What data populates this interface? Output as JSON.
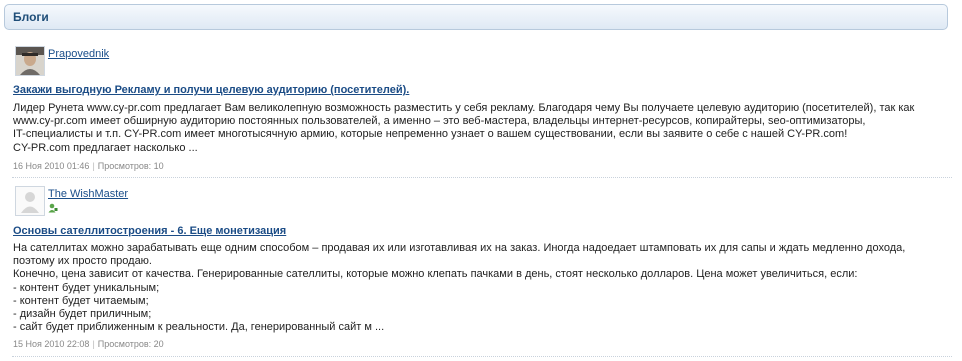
{
  "header": {
    "title": "Блоги"
  },
  "posts": [
    {
      "author": "Prapovednik",
      "title": "Закажи выгодную Рекламу и получи целевую аудиторию (посетителей).",
      "body_lines": [
        "Лидер Рунета www.cy-pr.com предлагает Вам великолепную возможность разместить у себя рекламу. Благодаря чему Вы получаете целевую аудиторию (посетителей), так как",
        "www.cy-pr.com имеет обширную аудиторию постоянных пользователей, а именно – это веб-мастера, владельцы интернет-ресурсов, копирайтеры, seo-оптимизаторы,",
        "IT-специалисты и т.п. CY-PR.com имеет многотысячную армию, которые непременно узнает о вашем существовании, если вы заявите о себе с нашей CY-PR.com!",
        "CY-PR.com предлагает насколько ..."
      ],
      "date": "16 Ноя 2010 01:46",
      "views": "Просмотров: 10"
    },
    {
      "author": "The WishMaster",
      "title": "Основы сателлитостроения - 6. Еще монетизация",
      "body_lines": [
        "На сателлитах можно зарабатывать еще одним способом – продавая их или изготавливая их на заказ. Иногда надоедает штамповать их для сапы и ждать медленно дохода,",
        "поэтому их просто продаю.",
        "Конечно, цена зависит от качества. Генерированные сателлиты, которые можно клепать пачками в день, стоят несколько долларов. Цена может увеличиться, если:",
        "- контент будет уникальным;",
        "- контент будет читаемым;",
        "- дизайн будет приличным;",
        "- сайт будет приближенным к реальности. Да, генерированный сайт м ..."
      ],
      "date": "15 Ноя 2010 22:08",
      "views": "Просмотров: 20"
    }
  ]
}
